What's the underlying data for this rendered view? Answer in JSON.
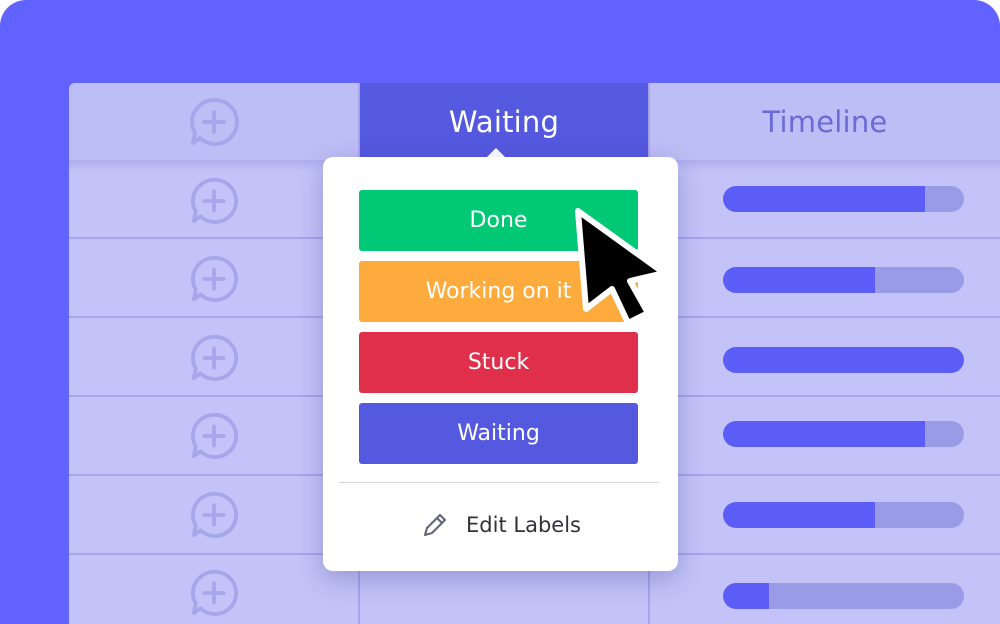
{
  "board": {
    "status_header": "Waiting",
    "timeline_header": "Timeline",
    "timeline_progress": [
      0.84,
      0.63,
      1.0,
      0.84,
      0.63,
      0.19
    ]
  },
  "status_popup": {
    "labels": [
      {
        "text": "Done",
        "color": "#00c875"
      },
      {
        "text": "Working on it",
        "color": "#fdab3d"
      },
      {
        "text": "Stuck",
        "color": "#df2f4a"
      },
      {
        "text": "Waiting",
        "color": "#5559df"
      }
    ],
    "edit_labels": "Edit Labels"
  },
  "icons": {
    "add_column": "add-chat-icon",
    "edit": "pencil-icon",
    "cursor": "mouse-pointer-icon"
  },
  "colors": {
    "frame": "#6262ff",
    "board": "#c3c3f9",
    "status_header": "#5559df",
    "timeline_fill": "#5c5cf7",
    "timeline_track": "#999be6"
  }
}
